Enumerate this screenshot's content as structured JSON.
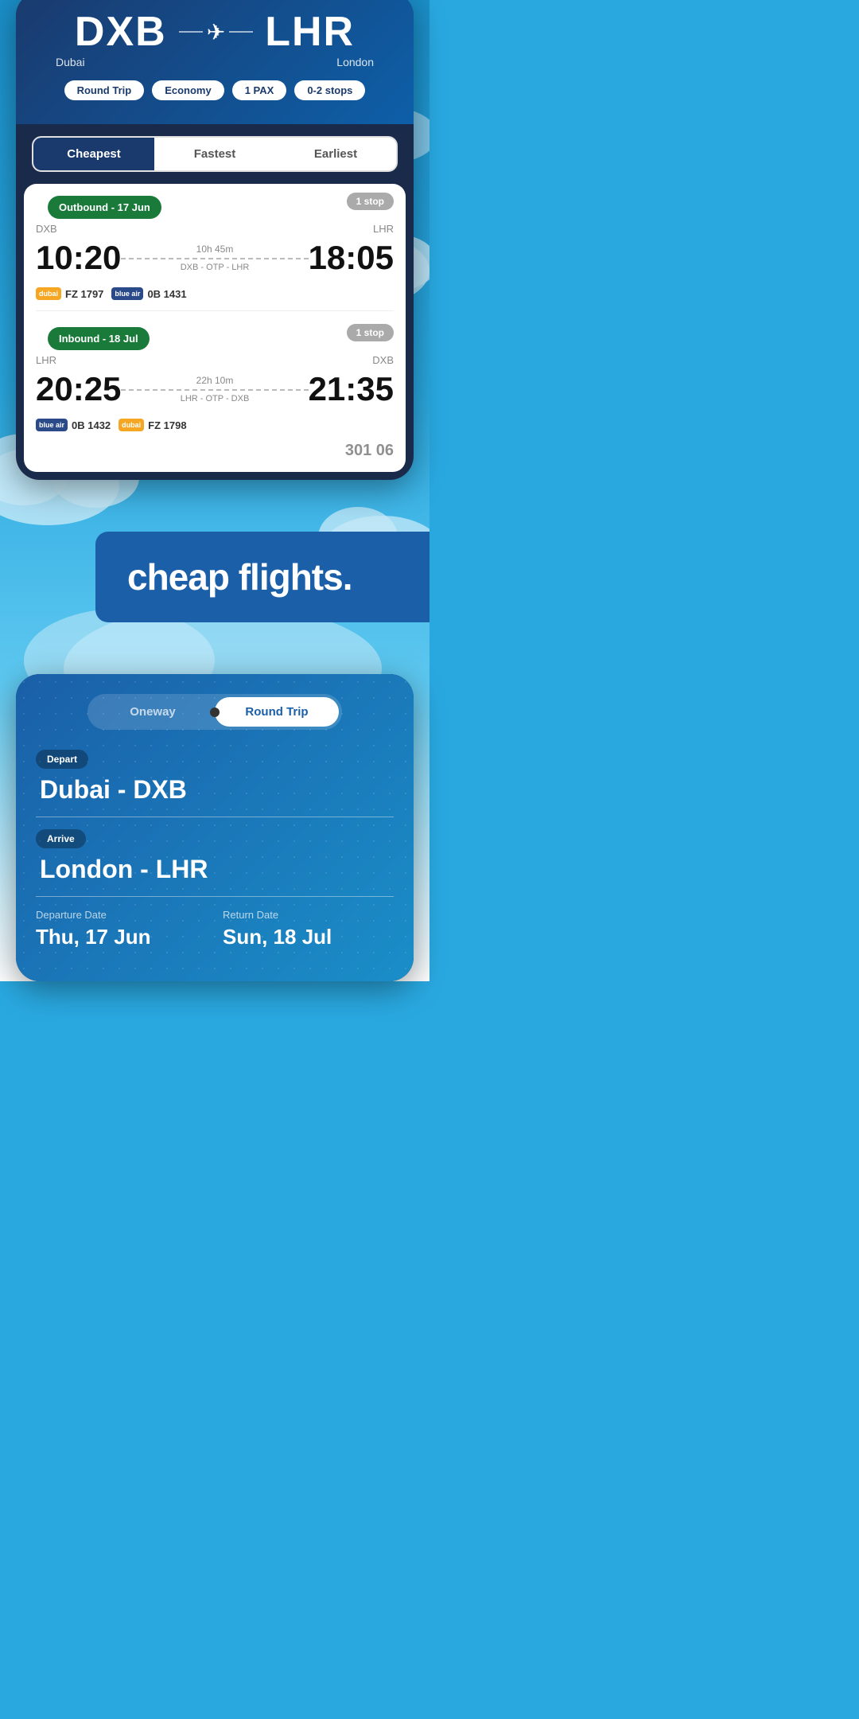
{
  "top_phone": {
    "origin_code": "DXB",
    "origin_city": "Dubai",
    "destination_code": "LHR",
    "destination_city": "London",
    "filters": {
      "trip_type": "Round Trip",
      "cabin": "Economy",
      "passengers": "1 PAX",
      "stops": "0-2 stops"
    },
    "tabs": [
      {
        "label": "Cheapest",
        "active": true
      },
      {
        "label": "Fastest",
        "active": false
      },
      {
        "label": "Earliest",
        "active": false
      }
    ],
    "outbound": {
      "label": "Outbound - 17 Jun",
      "stop_badge": "1 stop",
      "origin": "DXB",
      "destination": "LHR",
      "depart_time": "10:20",
      "arrive_time": "18:05",
      "duration": "10h 45m",
      "route": "DXB - OTP - LHR",
      "flights": [
        {
          "logo_type": "dubai",
          "logo_text": "dubai",
          "flight_no": "FZ 1797"
        },
        {
          "logo_type": "blue",
          "logo_text": "blue air",
          "flight_no": "0B 1431"
        }
      ]
    },
    "inbound": {
      "label": "Inbound - 18 Jul",
      "stop_badge": "1 stop",
      "origin": "LHR",
      "destination": "DXB",
      "depart_time": "20:25",
      "arrive_time": "21:35",
      "duration": "22h 10m",
      "route": "LHR - OTP - DXB",
      "flights": [
        {
          "logo_type": "blue",
          "logo_text": "blue air",
          "flight_no": "0B 1432"
        },
        {
          "logo_type": "dubai",
          "logo_text": "dubai",
          "flight_no": "FZ 1798"
        }
      ]
    },
    "price_peek": "301 06"
  },
  "banner": {
    "text": "cheap flights."
  },
  "bottom_phone": {
    "toggle": {
      "option1": "Oneway",
      "option2": "Round Trip",
      "active": "Round Trip"
    },
    "depart_label": "Depart",
    "depart_city": "Dubai - DXB",
    "arrive_label": "Arrive",
    "arrive_city": "London - LHR",
    "departure_date_label": "Departure Date",
    "departure_date": "Thu, 17 Jun",
    "return_date_label": "Return Date",
    "return_date": "Sun, 18 Jul"
  }
}
